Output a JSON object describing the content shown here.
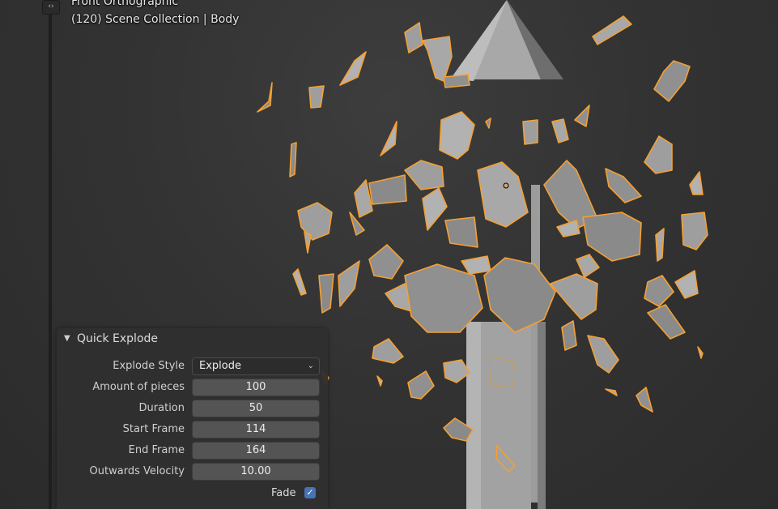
{
  "viewport": {
    "view_mode": "Front Orthographic",
    "scene_info": "(120) Scene Collection | Body",
    "selection_outline_color": "#f5a033",
    "toggle_icon": "sidebar-toggle-icon",
    "toggle_glyph": "‹›"
  },
  "panel": {
    "title": "Quick Explode",
    "collapse_glyph": "▼",
    "explode_style": {
      "label": "Explode Style",
      "value": "Explode",
      "chevron": "⌄"
    },
    "fields": [
      {
        "label": "Amount of pieces",
        "value": "100"
      },
      {
        "label": "Duration",
        "value": "50"
      },
      {
        "label": "Start Frame",
        "value": "114"
      },
      {
        "label": "End Frame",
        "value": "164"
      },
      {
        "label": "Outwards Velocity",
        "value": "10.00"
      }
    ],
    "fade": {
      "label": "Fade",
      "checked": true,
      "check_glyph": "✓"
    },
    "accent_color": "#4772b3"
  }
}
